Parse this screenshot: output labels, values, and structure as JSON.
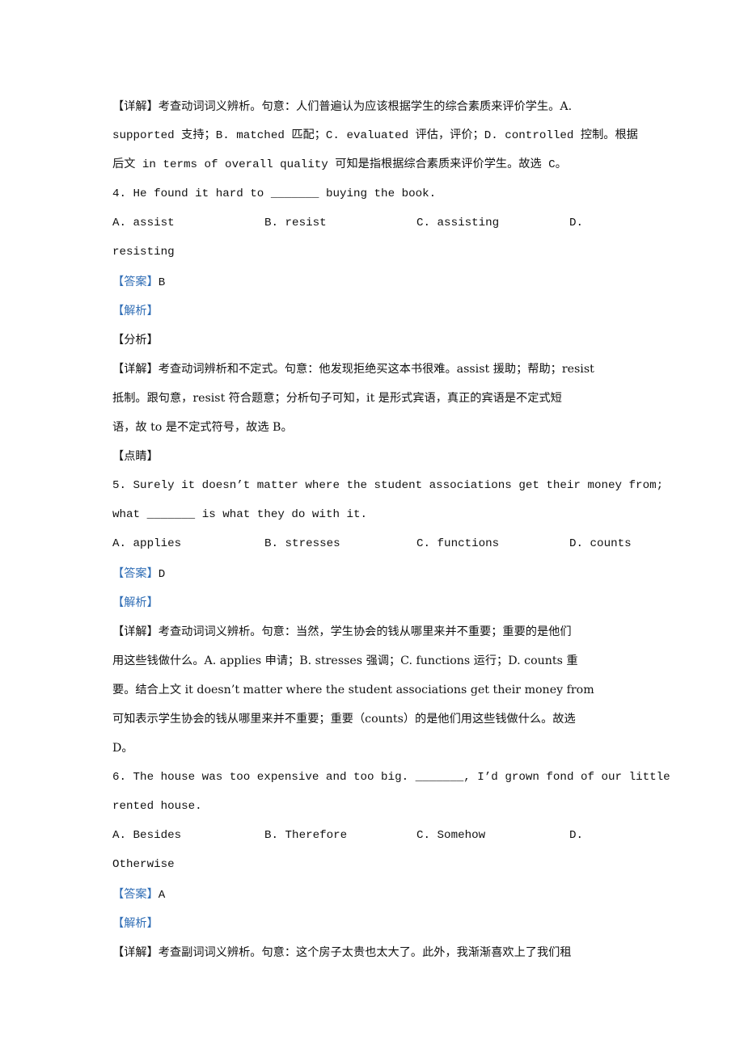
{
  "blocks": {
    "q3_detail": {
      "label": "【详解】",
      "lines": [
        "考查动词词义辨析。句意：人们普遍认为应该根据学生的综合素质来评价学生。A.",
        "supported 支持；B. matched 匹配；C. evaluated 评估，评价；D. controlled 控制。根据",
        "后文 in terms of overall quality 可知是指根据综合素质来评价学生。故选 C。"
      ]
    },
    "q4": {
      "stem_before": "4. He found it hard to ",
      "stem_blank": "_______",
      "stem_after": " buying the book.",
      "options": [
        "A. assist",
        "B. resist",
        "C. assisting",
        "D."
      ],
      "option_wrap": "resisting",
      "answer_label": "【答案】",
      "answer_value": "B",
      "analysis_label": "【解析】",
      "fenxi_label": "【分析】",
      "detail_label": "【详解】",
      "detail_lines": [
        "考查动词辨析和不定式。句意：他发现拒绝买这本书很难。assist 援助；帮助；resist",
        "抵制。跟句意，resist 符合题意；分析句子可知，it 是形式宾语，真正的宾语是不定式短",
        "语，故 to 是不定式符号，故选 B。"
      ],
      "dianjing_label": "【点睛】"
    },
    "q5": {
      "stem_line1": "5. Surely it doesn’t matter where the student associations get their money from;",
      "stem_line2_before": "what ",
      "stem_blank": "_______",
      "stem_line2_after": " is what they do with it.",
      "options": [
        "A. applies",
        "B. stresses",
        "C. functions",
        "D. counts"
      ],
      "answer_label": "【答案】",
      "answer_value": "D",
      "analysis_label": "【解析】",
      "detail_label": "【详解】",
      "detail_lines": [
        "考查动词词义辨析。句意：当然，学生协会的钱从哪里来并不重要；重要的是他们",
        "用这些钱做什么。A. applies 申请；B. stresses 强调；C. functions 运行；D. counts 重",
        "要。结合上文 it doesn’t matter where the student associations get their money from",
        "可知表示学生协会的钱从哪里来并不重要；重要（counts）的是他们用这些钱做什么。故选",
        "D。"
      ]
    },
    "q6": {
      "stem_line1_before": "6. The house was too expensive and too big. ",
      "stem_blank": "_______",
      "stem_line1_after": ", I’d grown fond of our little",
      "stem_line2": "rented house.",
      "options": [
        "A. Besides",
        "B. Therefore",
        "C. Somehow",
        "D."
      ],
      "option_wrap": "Otherwise",
      "answer_label": "【答案】",
      "answer_value": "A",
      "analysis_label": "【解析】",
      "detail_label": "【详解】",
      "detail_lines": [
        "考查副词词义辨析。句意：这个房子太贵也太大了。此外，我渐渐喜欢上了我们租"
      ]
    }
  },
  "colors": {
    "label_blue": "#2f6db5",
    "text": "#111111"
  }
}
